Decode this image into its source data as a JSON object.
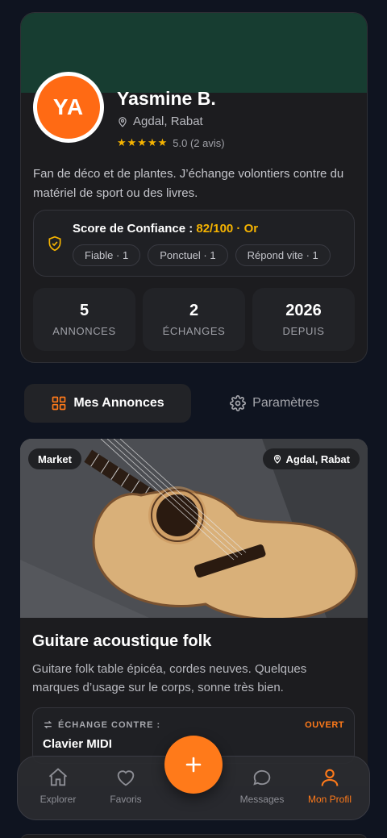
{
  "profile": {
    "initials": "YA",
    "name": "Yasmine B.",
    "location": "Agdal, Rabat",
    "stars": "★★★★★",
    "rating_text": "5.0 (2 avis)",
    "bio": "Fan de déco et de plantes. J’échange volontiers contre du matériel de sport ou des livres.",
    "colors": {
      "cover": "#173d31",
      "avatar": "#ff6a14",
      "accent": "#ff7a1a",
      "gold": "#f5b301"
    }
  },
  "trust": {
    "label": "Score de Confiance : ",
    "score": "82/100 · Or",
    "chips": [
      "Fiable · 1",
      "Ponctuel · 1",
      "Répond vite · 1"
    ]
  },
  "stats": [
    {
      "value": "5",
      "label": "ANNONCES"
    },
    {
      "value": "2",
      "label": "ÉCHANGES"
    },
    {
      "value": "2026",
      "label": "DEPUIS"
    }
  ],
  "tabs": [
    {
      "label": "Mes Annonces",
      "icon": "grid-icon",
      "active": true
    },
    {
      "label": "Paramètres",
      "icon": "gear-icon",
      "active": false
    }
  ],
  "listing": {
    "badge": "Market",
    "location": "Agdal, Rabat",
    "title": "Guitare acoustique folk",
    "description": "Guitare folk table épicéa, cordes neuves. Quelques marques d’usage sur le corps, sonne très bien.",
    "exchange_label": "ÉCHANGE CONTRE :",
    "exchange_status": "OUVERT",
    "exchange_value": "Clavier MIDI"
  },
  "nav": {
    "items": [
      {
        "label": "Explorer",
        "icon": "home-icon"
      },
      {
        "label": "Favoris",
        "icon": "heart-icon"
      },
      {
        "label": "Messages",
        "icon": "chat-icon"
      },
      {
        "label": "Mon Profil",
        "icon": "user-icon",
        "active": true
      }
    ],
    "fab_icon": "plus-icon"
  }
}
